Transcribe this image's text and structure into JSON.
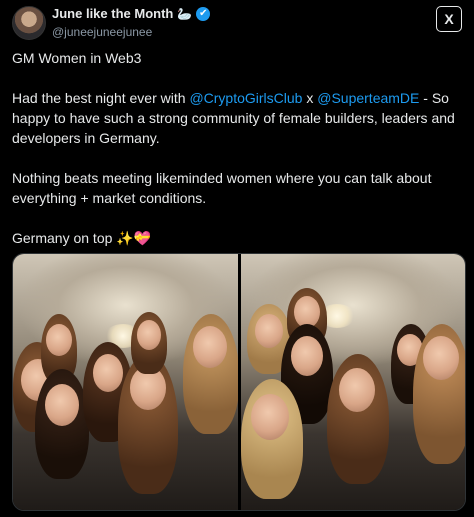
{
  "author": {
    "display_name": "June like the Month",
    "name_emoji": "🦢",
    "verified_icon": "✔",
    "handle": "@juneejuneejunee"
  },
  "brand_logo": "X",
  "tweet": {
    "line1": "GM Women in Web3",
    "p2_pre": "Had the best night ever with ",
    "mention1": "@CryptoGirlsClub",
    "p2_mid": " x ",
    "mention2": "@SuperteamDE",
    "p2_post": " - So happy to have such a strong community of female builders, leaders and developers in Germany.",
    "p3": "Nothing beats meeting likeminded women where you can talk about everything + market conditions.",
    "p4": "Germany on top ✨💝"
  },
  "colors": {
    "background": "#000000",
    "text": "#e7e9ea",
    "secondary": "#8b98a5",
    "link": "#1d9bf0"
  },
  "media": {
    "count": 2
  }
}
